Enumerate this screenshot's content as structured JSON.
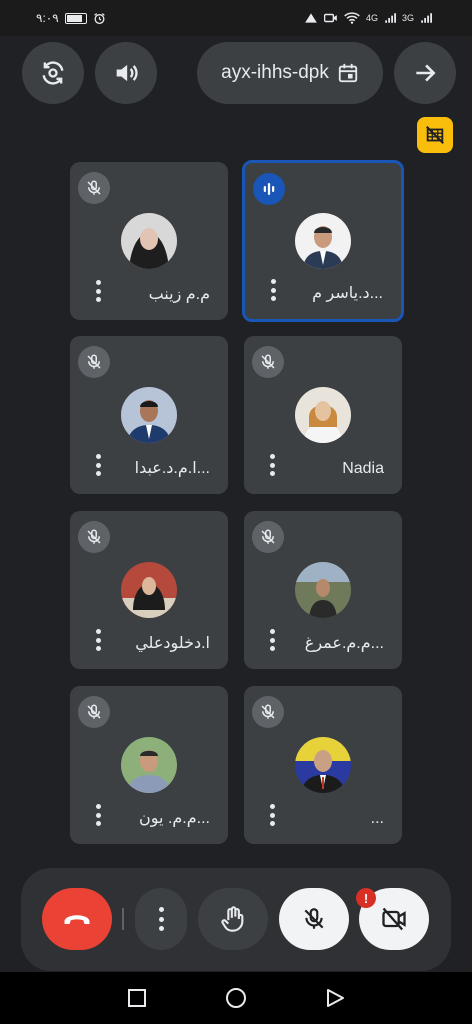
{
  "status_bar": {
    "time": "٩:٠٩",
    "net_4g": "4G",
    "net_3g": "3G"
  },
  "top_bar": {
    "meeting_code": "ayx-ihhs-dpk",
    "icons": [
      "switch-camera-icon",
      "speaker-icon",
      "calendar-icon",
      "arrow-right-icon"
    ]
  },
  "participants": [
    {
      "name": "م.م زينب",
      "mic": "muted",
      "speaking": false
    },
    {
      "name": "د.ياسر م...",
      "mic": "speaking",
      "speaking": true
    },
    {
      "name": "ا.م.د.عبدا...",
      "mic": "muted",
      "speaking": false
    },
    {
      "name": "Nadia",
      "mic": "muted",
      "speaking": false
    },
    {
      "name": "ا.دخلودعلي",
      "mic": "muted",
      "speaking": false
    },
    {
      "name": "م.م.عمرغ...",
      "mic": "muted",
      "speaking": false
    },
    {
      "name": "م.م. يون...",
      "mic": "muted",
      "speaking": false
    },
    {
      "name": "...",
      "mic": "muted",
      "speaking": false
    }
  ],
  "controls": {
    "alert_badge": "!"
  },
  "colors": {
    "background": "#202124",
    "tile": "#3c4043",
    "speaking_border": "#1a56b8",
    "hangup": "#ea4335",
    "badge_yellow": "#f9bd0b"
  }
}
